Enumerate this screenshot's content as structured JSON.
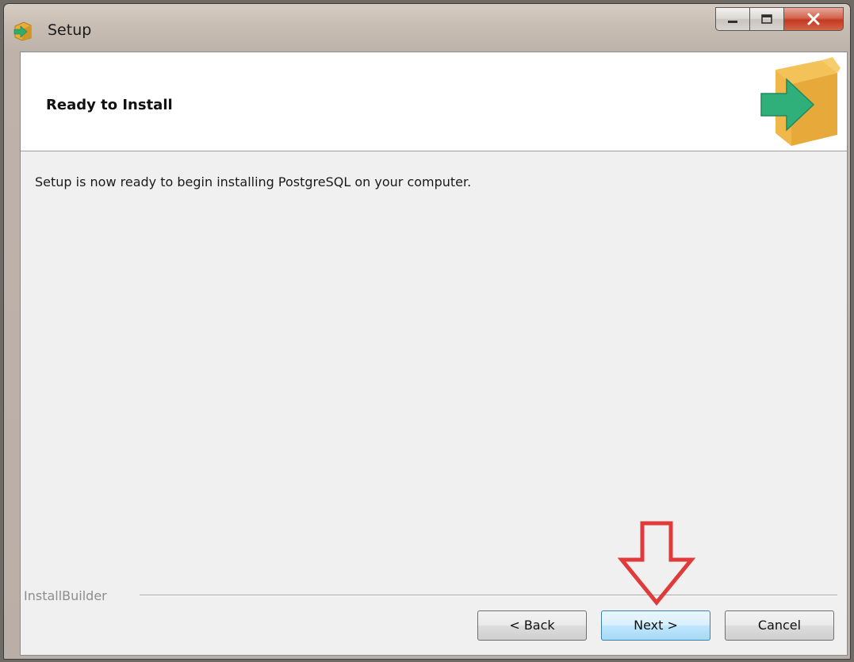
{
  "window": {
    "title": "Setup",
    "icon": "setup-box-arrow-icon",
    "caption_icons": [
      "minimize-icon",
      "maximize-icon",
      "close-icon"
    ]
  },
  "header": {
    "title": "Ready to Install",
    "logo_icon": "package-arrow-icon"
  },
  "content": {
    "message": "Setup is now ready to begin installing PostgreSQL on your computer."
  },
  "footer": {
    "brand": "InstallBuilder",
    "back_label": "< Back",
    "next_label": "Next >",
    "cancel_label": "Cancel"
  },
  "annotation": {
    "icon": "down-arrow-icon",
    "color": "#e03a3a"
  },
  "colors": {
    "close_button": "#c2391f",
    "next_button": "#bee6fd",
    "package": "#f0b23c",
    "package_arrow": "#2fb07a"
  }
}
